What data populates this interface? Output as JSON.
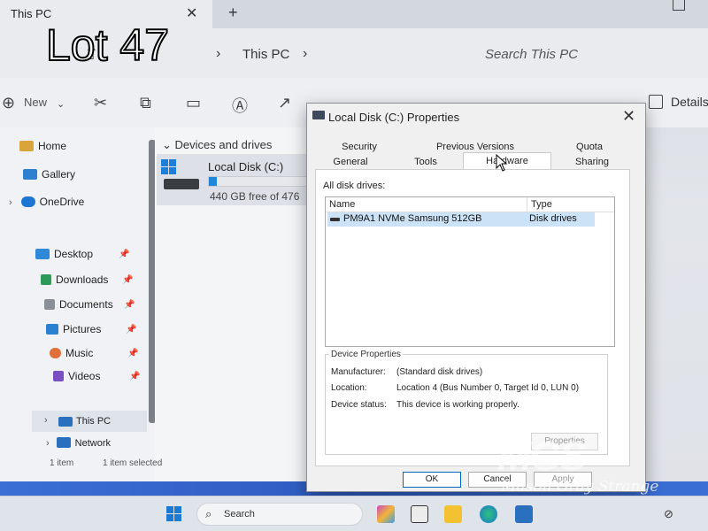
{
  "window": {
    "tab_title": "This PC",
    "close_glyph": "✕",
    "new_tab_glyph": "+"
  },
  "address": {
    "breadcrumb": "This PC",
    "search_placeholder": "Search This PC"
  },
  "toolbar": {
    "new_label": "New",
    "details_label": "Details"
  },
  "sidebar": {
    "items": [
      {
        "label": "Home",
        "icon": "home-icon"
      },
      {
        "label": "Gallery",
        "icon": "gallery-icon"
      },
      {
        "label": "OneDrive",
        "icon": "cloud-icon"
      },
      {
        "label": "Desktop",
        "icon": "desktop-icon",
        "pinned": true
      },
      {
        "label": "Downloads",
        "icon": "download-icon",
        "pinned": true
      },
      {
        "label": "Documents",
        "icon": "documents-icon",
        "pinned": true
      },
      {
        "label": "Pictures",
        "icon": "pictures-icon",
        "pinned": true
      },
      {
        "label": "Music",
        "icon": "music-icon",
        "pinned": true
      },
      {
        "label": "Videos",
        "icon": "videos-icon",
        "pinned": true
      },
      {
        "label": "This PC",
        "icon": "computer-icon"
      },
      {
        "label": "Network",
        "icon": "network-icon"
      }
    ]
  },
  "content": {
    "section_header": "Devices and drives",
    "drive": {
      "name": "Local Disk (C:)",
      "free_text": "440 GB free of 476",
      "used_fraction": 0.08
    }
  },
  "status": {
    "item_count": "1 item",
    "selected": "1 item selected"
  },
  "dialog": {
    "title": "Local Disk (C:) Properties",
    "tabs_row1": [
      "Security",
      "Previous Versions",
      "Quota"
    ],
    "tabs_row2": [
      "General",
      "Tools",
      "Hardware",
      "Sharing"
    ],
    "active_tab": "Hardware",
    "all_disk_drives_label": "All disk drives:",
    "columns": [
      "Name",
      "Type"
    ],
    "rows": [
      {
        "name": "PM9A1 NVMe Samsung 512GB",
        "type": "Disk drives"
      }
    ],
    "device_properties_label": "Device Properties",
    "manufacturer_label": "Manufacturer:",
    "manufacturer_value": "(Standard disk drives)",
    "location_label": "Location:",
    "location_value": "Location 4 (Bus Number 0, Target Id 0, LUN 0)",
    "status_label": "Device status:",
    "status_value": "This device is working properly.",
    "properties_button": "Properties",
    "ok_button": "OK",
    "cancel_button": "Cancel",
    "apply_button": "Apply"
  },
  "overlay": {
    "lot_text": "Lot 47"
  },
  "watermark": {
    "logo_text": "MGS",
    "name_text": "Mason Gray Strange"
  },
  "taskbar": {
    "search_placeholder": "Search"
  }
}
